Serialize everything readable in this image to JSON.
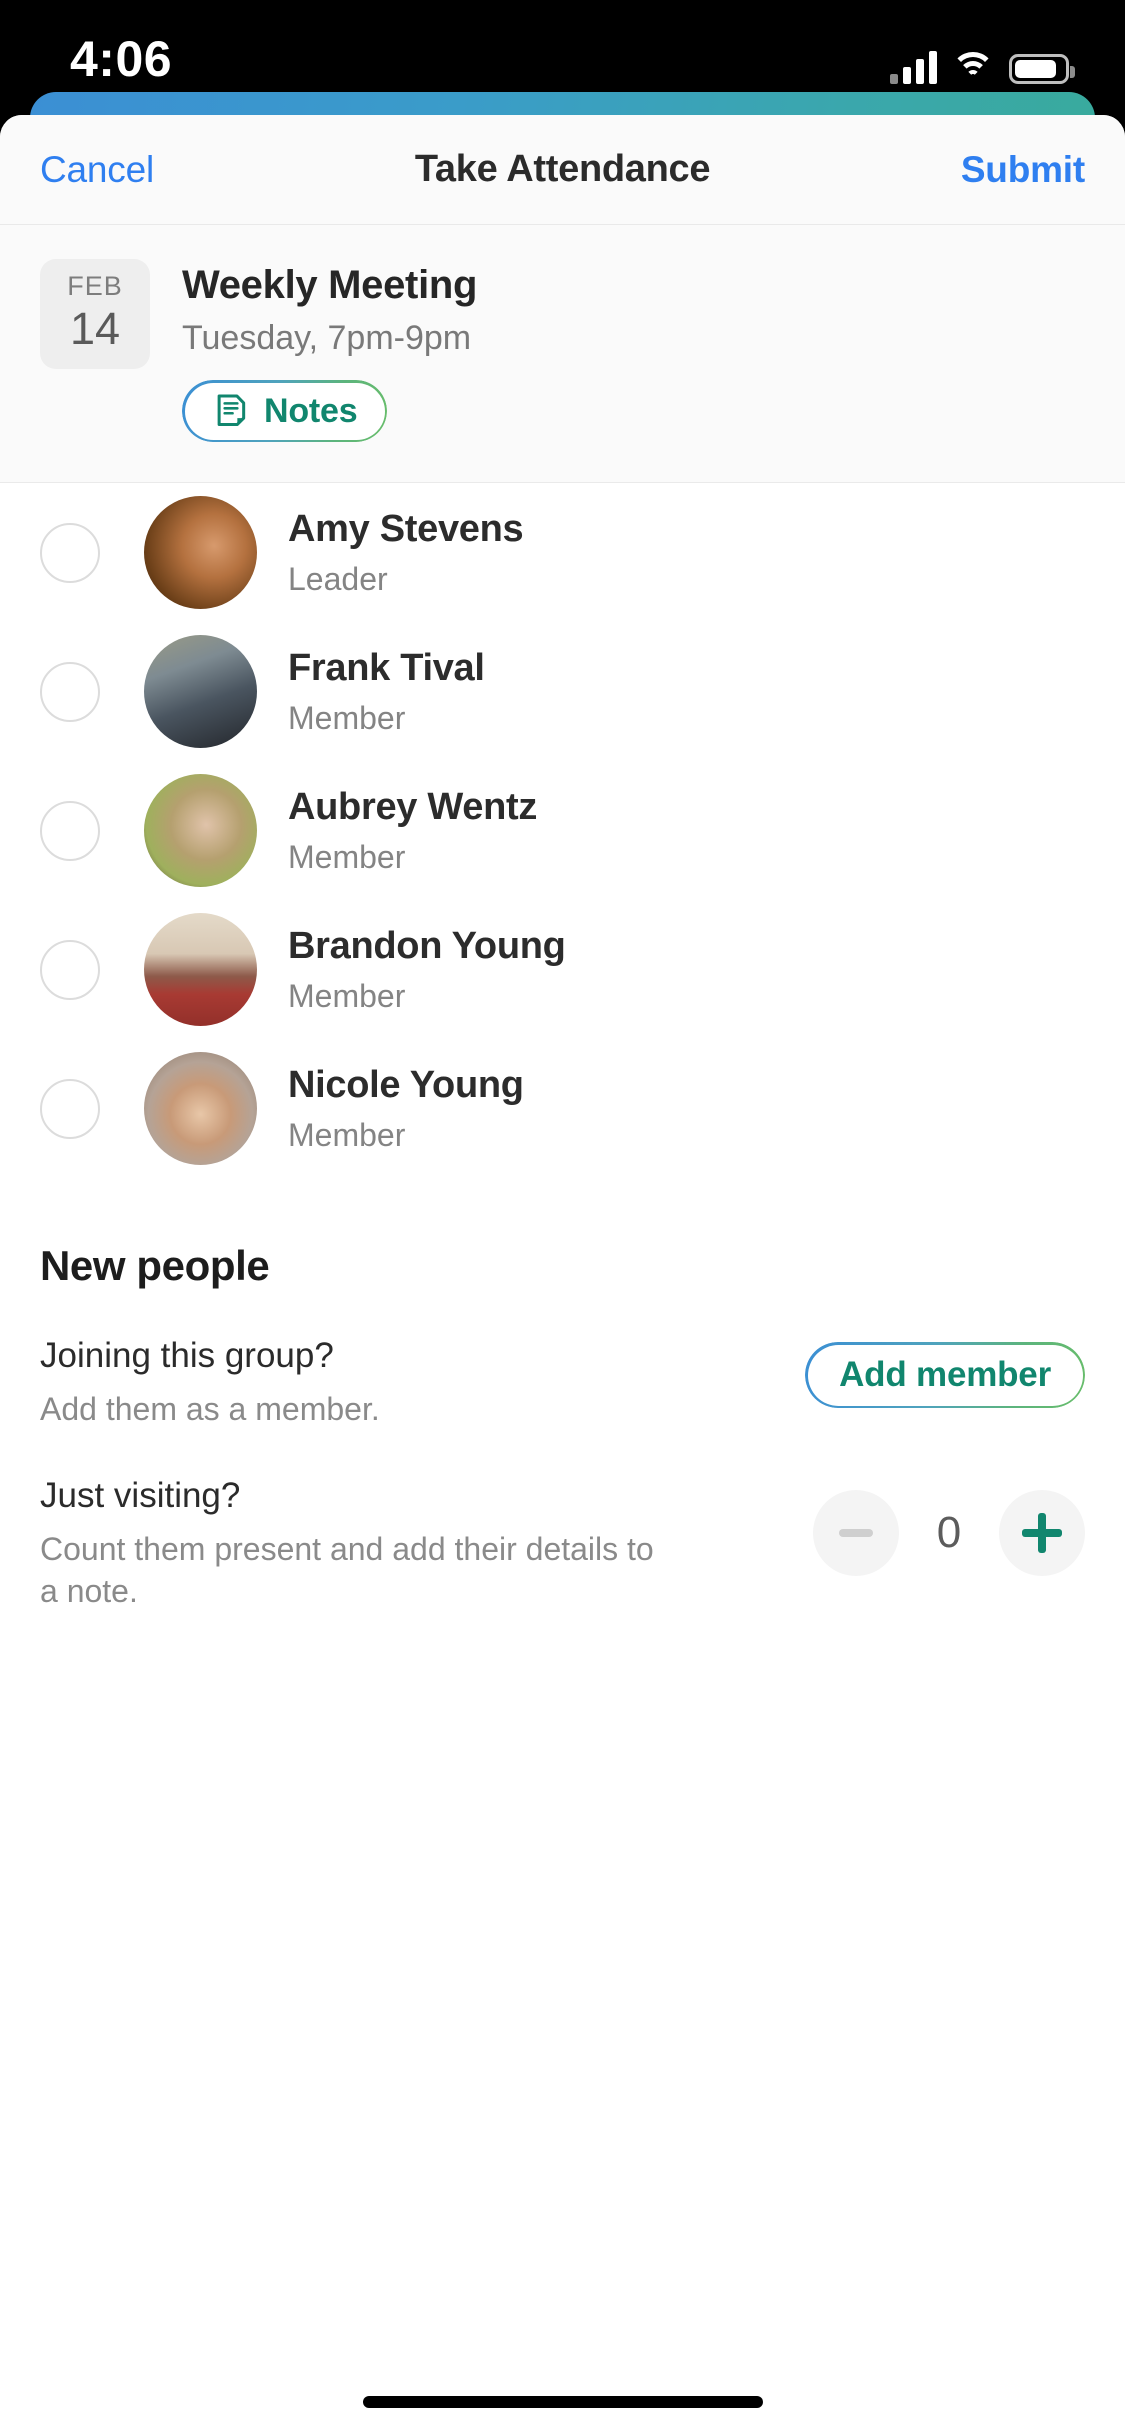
{
  "status_bar": {
    "time": "4:06",
    "cellular_icon": "cellular-bars-icon",
    "wifi_icon": "wifi-icon",
    "battery_icon": "battery-icon"
  },
  "navbar": {
    "cancel_label": "Cancel",
    "title": "Take Attendance",
    "submit_label": "Submit"
  },
  "meeting": {
    "date_month": "FEB",
    "date_day": "14",
    "title": "Weekly Meeting",
    "subtitle": "Tuesday, 7pm-9pm",
    "notes_label": "Notes",
    "notes_icon": "document-note-icon"
  },
  "roster": [
    {
      "name": "Amy Stevens",
      "role": "Leader",
      "checked": false,
      "avatar_color_a": "#7a4a21",
      "avatar_color_b": "#c98a55"
    },
    {
      "name": "Frank Tival",
      "role": "Member",
      "checked": false,
      "avatar_color_a": "#6f7c86",
      "avatar_color_b": "#2d3138"
    },
    {
      "name": "Aubrey Wentz",
      "role": "Member",
      "checked": false,
      "avatar_color_a": "#aab96a",
      "avatar_color_b": "#4a3b33"
    },
    {
      "name": "Brandon Young",
      "role": "Member",
      "checked": false,
      "avatar_color_a": "#ded3c2",
      "avatar_color_b": "#a43a33"
    },
    {
      "name": "Nicole Young",
      "role": "Member",
      "checked": false,
      "avatar_color_a": "#c4b2a4",
      "avatar_color_b": "#6b4a3a"
    }
  ],
  "new_people": {
    "section_title": "New people",
    "joining": {
      "question": "Joining this group?",
      "description": "Add them as a member.",
      "button_label": "Add member"
    },
    "visiting": {
      "question": "Just visiting?",
      "description": "Count them present and add their details to a note.",
      "decrement_label": "−",
      "increment_label": "+",
      "count": "0"
    }
  },
  "colors": {
    "accent_blue": "#2f7ff0",
    "accent_teal": "#11866e",
    "gradient_start": "#3b8fd4",
    "gradient_end": "#68bd6a"
  }
}
